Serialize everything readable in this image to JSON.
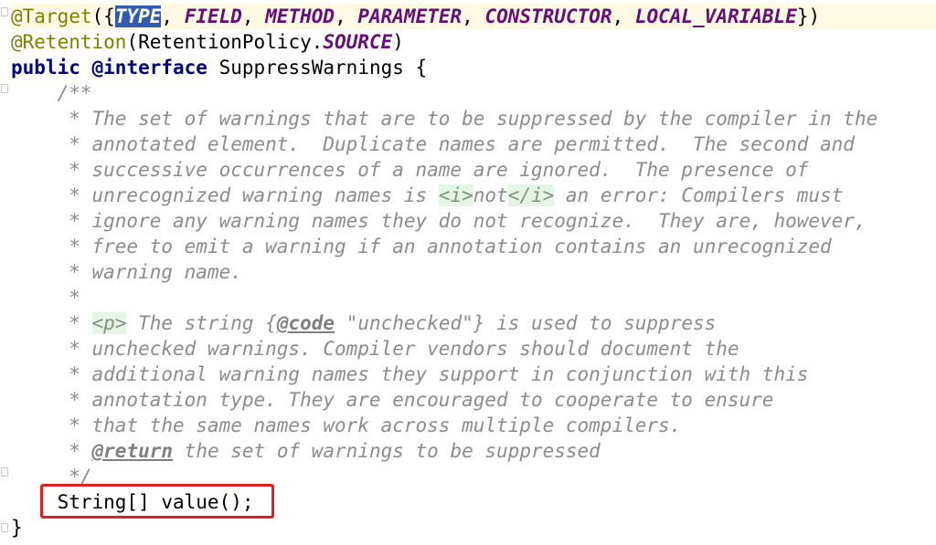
{
  "editor": {
    "line1": {
      "at_target": "@Target",
      "open": "({",
      "type": "TYPE",
      "sep1": ", ",
      "field": "FIELD",
      "sep2": ", ",
      "method": "METHOD",
      "sep3": ", ",
      "parameter": "PARAMETER",
      "sep4": ", ",
      "constructor": "CONSTRUCTOR",
      "sep5": ", ",
      "local_variable": "LOCAL_VARIABLE",
      "close": "})"
    },
    "line2": {
      "retention": "@Retention",
      "open": "(RetentionPolicy.",
      "source": "SOURCE",
      "close": ")"
    },
    "line3": {
      "public": "public",
      "sp": " ",
      "interface": "@interface",
      "name": " SuppressWarnings {"
    },
    "doc": {
      "open": "    /**",
      "l1": "     * The set of warnings that are to be suppressed by the compiler in the",
      "l2": "     * annotated element.  Duplicate names are permitted.  The second and",
      "l3": "     * successive occurrences of a name are ignored.  The presence of",
      "l4_a": "     * unrecognized warning names is ",
      "l4_tag_open": "<i>",
      "l4_mid": "not",
      "l4_tag_close": "</i>",
      "l4_b": " an error: Compilers must",
      "l5": "     * ignore any warning names they do not recognize.  They are, however,",
      "l6": "     * free to emit a warning if an annotation contains an unrecognized",
      "l7": "     * warning name.",
      "l8": "     *",
      "l9_a": "     * ",
      "l9_tag": "<p>",
      "l9_b": " The string {",
      "l9_code": "@code",
      "l9_c": " \"unchecked\"} is used to suppress",
      "l10": "     * unchecked warnings. Compiler vendors should document the",
      "l11": "     * additional warning names they support in conjunction with this",
      "l12": "     * annotation type. They are encouraged to cooperate to ensure",
      "l13": "     * that the same names work across multiple compilers.",
      "l14_a": "     * ",
      "l14_tag": "@return",
      "l14_b": " the set of warnings to be suppressed",
      "close": "     */"
    },
    "method_line": "    String[] value();",
    "closing_brace": "}"
  },
  "colors": {
    "highlight_box": "#e02020",
    "current_line": "#fffae3",
    "selection": "#2f5cb0"
  }
}
